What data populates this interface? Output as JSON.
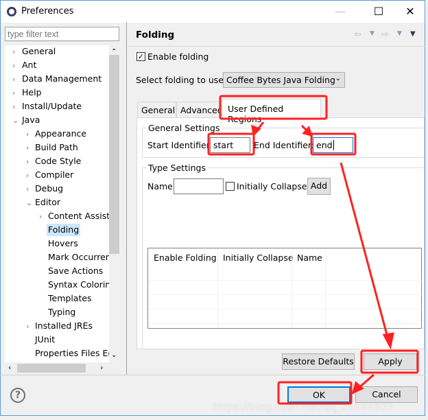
{
  "window": {
    "title": "Preferences",
    "minimize": "—",
    "maximize": "☐",
    "close": "✕"
  },
  "sidebar": {
    "filter_placeholder": "type filter text",
    "items": [
      {
        "label": "General",
        "level": 0,
        "expanded": false
      },
      {
        "label": "Ant",
        "level": 0,
        "expanded": false
      },
      {
        "label": "Data Management",
        "level": 0,
        "expanded": false
      },
      {
        "label": "Help",
        "level": 0,
        "expanded": false
      },
      {
        "label": "Install/Update",
        "level": 0,
        "expanded": false
      },
      {
        "label": "Java",
        "level": 0,
        "expanded": true
      },
      {
        "label": "Appearance",
        "level": 1,
        "expanded": false
      },
      {
        "label": "Build Path",
        "level": 1,
        "expanded": false
      },
      {
        "label": "Code Style",
        "level": 1,
        "expanded": false
      },
      {
        "label": "Compiler",
        "level": 1,
        "expanded": false
      },
      {
        "label": "Debug",
        "level": 1,
        "expanded": false
      },
      {
        "label": "Editor",
        "level": 1,
        "expanded": true
      },
      {
        "label": "Content Assist",
        "level": 2,
        "expanded": false
      },
      {
        "label": "Folding",
        "level": 2,
        "leaf": true,
        "selected": true
      },
      {
        "label": "Hovers",
        "level": 2,
        "leaf": true
      },
      {
        "label": "Mark Occurrences",
        "level": 2,
        "leaf": true
      },
      {
        "label": "Save Actions",
        "level": 2,
        "leaf": true
      },
      {
        "label": "Syntax Coloring",
        "level": 2,
        "leaf": true
      },
      {
        "label": "Templates",
        "level": 2,
        "leaf": true
      },
      {
        "label": "Typing",
        "level": 2,
        "leaf": true
      },
      {
        "label": "Installed JREs",
        "level": 1,
        "expanded": false
      },
      {
        "label": "JUnit",
        "level": 1,
        "leaf": true
      },
      {
        "label": "Properties Files Editor",
        "level": 1,
        "leaf": true
      }
    ]
  },
  "page": {
    "title": "Folding",
    "enable_folding": {
      "label": "Enable folding",
      "checked": true
    },
    "select_label": "Select folding to use:",
    "select_value": "Coffee Bytes Java Folding",
    "tabs": [
      {
        "label": "General"
      },
      {
        "label": "Advanced"
      },
      {
        "label": "User Defined Regions",
        "active": true
      }
    ],
    "general_settings": {
      "legend": "General Settings",
      "start_label": "Start Identifier:",
      "start_value": "start",
      "end_label": "End Identifier:",
      "end_value": "end"
    },
    "type_settings": {
      "legend": "Type Settings",
      "name_label": "Name",
      "name_value": "",
      "collapse_label": "Initially Collapse",
      "collapse_checked": false,
      "add_label": "Add"
    },
    "table": {
      "columns": [
        "Enable Folding",
        "Initially Collapse",
        "Name"
      ],
      "rows": []
    },
    "restore_defaults": "Restore Defaults",
    "apply": "Apply"
  },
  "footer": {
    "ok": "OK",
    "cancel": "Cancel",
    "help_icon": "?"
  },
  "watermark": "https://blog.csdn.net/qq_25844803",
  "colors": {
    "annotation": "#ff2020",
    "focus": "#0078d7",
    "selection": "#cce8ff"
  }
}
